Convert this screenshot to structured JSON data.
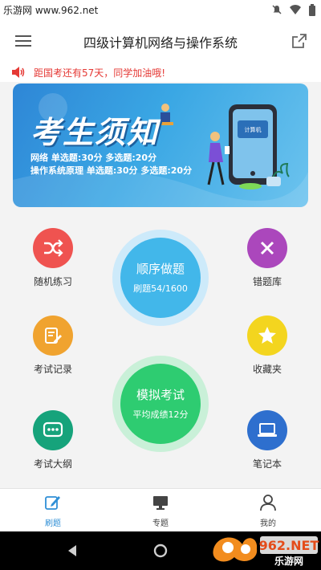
{
  "status_bar": {
    "watermark": "乐游网 www.962.net",
    "icons": [
      "mute-icon",
      "wifi-icon",
      "battery-icon"
    ]
  },
  "header": {
    "title": "四级计算机网络与操作系统",
    "menu_icon": "hamburger-icon",
    "share_icon": "share-icon"
  },
  "notice": {
    "text": "距国考还有57天，同学加油哦!",
    "icon": "speaker-icon"
  },
  "banner": {
    "title": "考生须知",
    "line1": "网络  单选题:30分  多选题:20分",
    "line2": "操作系统原理  单选题:30分  多选题:20分",
    "phone_badge": "计算机"
  },
  "features": {
    "random": {
      "label": "随机练习",
      "icon": "shuffle-icon",
      "color": "#ef5350"
    },
    "wrong": {
      "label": "错题库",
      "icon": "close-icon",
      "color": "#ab47bc"
    },
    "records": {
      "label": "考试记录",
      "icon": "edit-icon",
      "color": "#f0a32f"
    },
    "favorites": {
      "label": "收藏夹",
      "icon": "star-icon",
      "color": "#f3d51f"
    },
    "outline": {
      "label": "考试大纲",
      "icon": "chat-dots-icon",
      "color": "#16a37b"
    },
    "notebook": {
      "label": "笔记本",
      "icon": "laptop-icon",
      "color": "#2e6fce"
    }
  },
  "sequential": {
    "title": "顺序做题",
    "progress_text": "刷题54/1600",
    "done": 54,
    "total": 1600,
    "color": "#42b7ea"
  },
  "mock_exam": {
    "title": "模拟考试",
    "score_text": "平均成绩12分",
    "color": "#2ecc71"
  },
  "tabs": [
    {
      "label": "刷题",
      "icon": "pencil-square-icon",
      "active": true
    },
    {
      "label": "专题",
      "icon": "monitor-icon",
      "active": false
    },
    {
      "label": "我的",
      "icon": "user-icon",
      "active": false
    }
  ],
  "colors": {
    "accent": "#2f8fd6",
    "notice": "#e53935"
  },
  "watermark_logo": {
    "text": "962.NET",
    "sub": "乐游网"
  }
}
